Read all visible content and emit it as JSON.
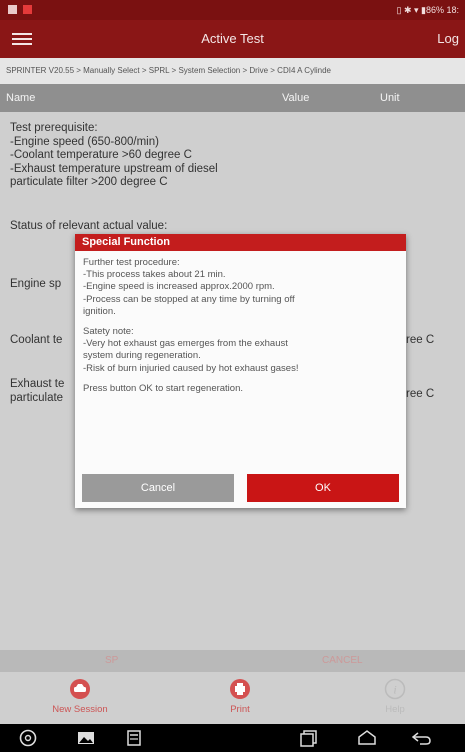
{
  "status_bar": {
    "right_text": "▯ ✱ ▾ ▮86% 18:"
  },
  "app_bar": {
    "title": "Active Test",
    "right_label": "Log"
  },
  "breadcrumb": "SPRINTER V20.55 > Manually Select > SPRL > System Selection > Drive > CDI4 A Cylinde",
  "table_header": {
    "name": "Name",
    "value": "Value",
    "unit": "Unit"
  },
  "content": {
    "prerequisite": [
      "Test prerequisite:",
      "-Engine speed (650-800/min)",
      "-Coolant temperature >60 degree C",
      "-Exhaust temperature upstream of diesel",
      "particulate filter >200 degree C"
    ],
    "status_heading": "Status of relevant actual value:",
    "rows": [
      {
        "name": "Engine sp",
        "unit": ""
      },
      {
        "name": "Coolant te",
        "unit": "ree C"
      },
      {
        "name": "Exhaust te",
        "name2": "particulate",
        "unit": "ree C"
      }
    ]
  },
  "dialog": {
    "title": "Special Function",
    "paragraphs": [
      [
        "Further test procedure:",
        "-This process takes about 21 min.",
        "-Engine speed is increased approx.2000 rpm.",
        "-Process can be stopped at any time by turning off",
        "ignition."
      ],
      [
        "Satety note:",
        "-Very hot exhaust gas emerges from the exhaust",
        "system during regeneration.",
        "-Risk of burn injuried caused by hot exhaust gases!"
      ],
      [
        "Press button OK to start regeneration."
      ]
    ],
    "cancel_label": "Cancel",
    "ok_label": "OK"
  },
  "bottom_tabs": {
    "left": "SP",
    "right": "CANCEL"
  },
  "actions": {
    "new_session": "New Session",
    "print": "Print",
    "help": "Help"
  },
  "icons": {
    "menu": "hamburger-icon",
    "car": "car-icon",
    "print": "printer-icon",
    "help": "info-icon",
    "browser": "browser-icon",
    "gallery": "gallery-icon",
    "calculator": "calculator-icon",
    "recents": "recents-icon",
    "home": "home-icon",
    "back": "back-icon"
  },
  "colors": {
    "app_bar": "#8a1616",
    "dialog_title": "#c31d1d",
    "ok_button": "#c91515",
    "cancel_button": "#9a9a9a"
  }
}
